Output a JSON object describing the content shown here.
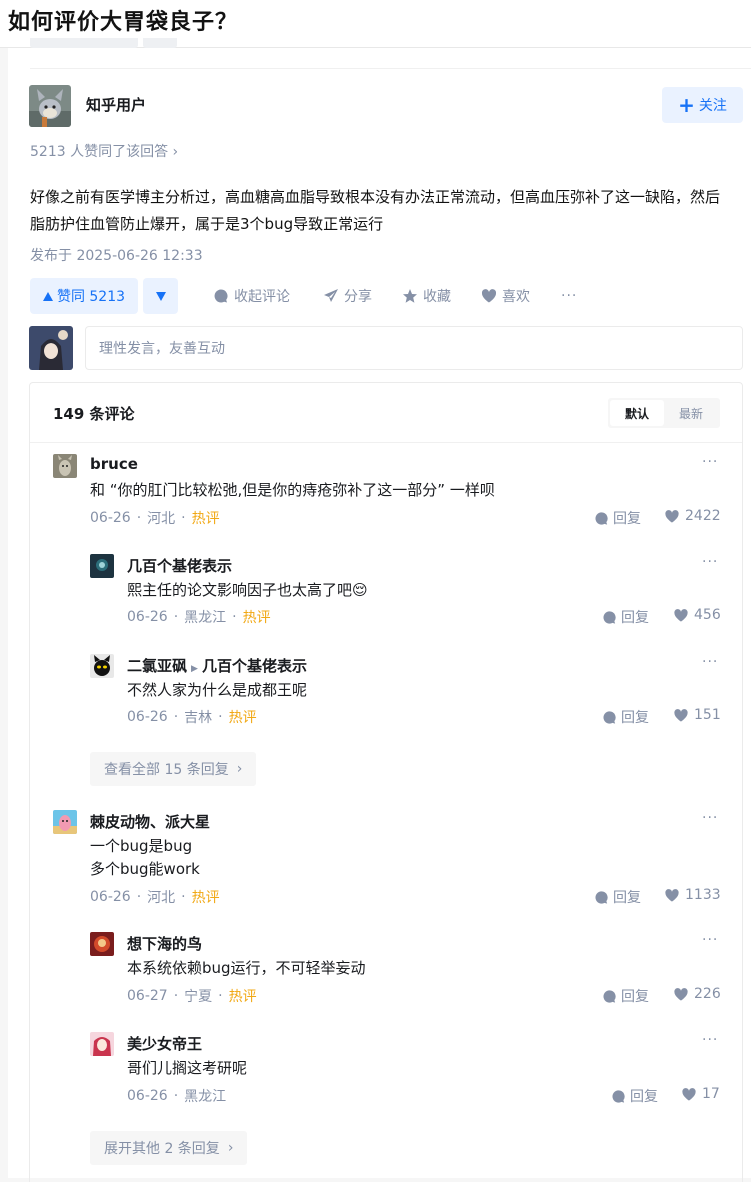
{
  "question": {
    "title": "如何评价大胃袋良子？"
  },
  "answer": {
    "author_name": "知乎用户",
    "follow_label": "关注",
    "upvote_summary": "5213 人赞同了该回答 ›",
    "body": "好像之前有医学博主分析过，高血糖高血脂导致根本没有办法正常流动，但高血压弥补了这一缺陷，然后脂肪护住血管防止爆开，属于是3个bug导致正常运行",
    "publish_time": "发布于 2025-06-26 12:33"
  },
  "actions": {
    "upvote_label": "赞同 5213",
    "collapse_comments": "收起评论",
    "share": "分享",
    "favorite": "收藏",
    "like": "喜欢",
    "more": "···"
  },
  "comment_input": {
    "placeholder": "理性发言，友善互动"
  },
  "comments": {
    "count_label": "149 条评论",
    "sort_default": "默认",
    "sort_newest": "最新",
    "reply_label": "回复",
    "hot_label": "热评",
    "threads": [
      {
        "name": "bruce",
        "text": "和 “你的肛门比较松弛,但是你的痔疮弥补了这一部分” 一样呗",
        "date": "06-26",
        "location": "河北",
        "hot": true,
        "likes": "2422",
        "replies": [
          {
            "name": "几百个基佬表示",
            "text": "熙主任的论文影响因子也太高了吧😌",
            "date": "06-26",
            "location": "黑龙江",
            "hot": true,
            "likes": "456"
          },
          {
            "name": "二氯亚砜",
            "reply_to": "几百个基佬表示",
            "text": "不然人家为什么是成都王呢",
            "date": "06-26",
            "location": "吉林",
            "hot": true,
            "likes": "151"
          }
        ],
        "expand_label": "查看全部 15 条回复"
      },
      {
        "name": "棘皮动物、派大星",
        "text_lines": [
          "一个bug是bug",
          "多个bug能work"
        ],
        "date": "06-26",
        "location": "河北",
        "hot": true,
        "likes": "1133",
        "replies": [
          {
            "name": "想下海的鸟",
            "text": "本系统依赖bug运行，不可轻举妄动",
            "date": "06-27",
            "location": "宁夏",
            "hot": true,
            "likes": "226"
          },
          {
            "name": "美少女帝王",
            "text": "哥们儿搁这考研呢",
            "date": "06-26",
            "location": "黑龙江",
            "hot": false,
            "likes": "17"
          }
        ],
        "expand_label": "展开其他 2 条回复"
      }
    ]
  },
  "colors": {
    "accent": "#1772f6",
    "accent_bg": "#eaf2ff",
    "muted": "#8590a6",
    "hot": "#f1a814"
  }
}
